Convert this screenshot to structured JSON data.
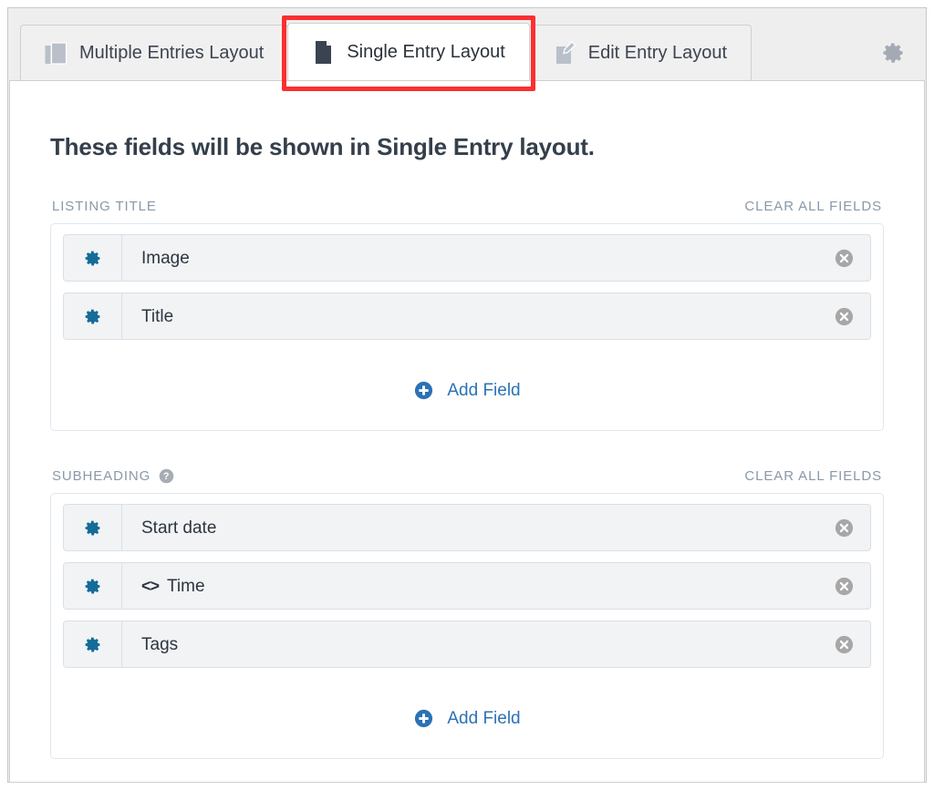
{
  "tabs": [
    {
      "label": "Multiple Entries Layout",
      "icon": "stacked-pages-icon",
      "active": false
    },
    {
      "label": "Single Entry Layout",
      "icon": "single-page-icon",
      "active": true
    },
    {
      "label": "Edit Entry Layout",
      "icon": "pencil-edit-icon",
      "active": false
    }
  ],
  "toolbar": {
    "settings_icon": "gear-icon"
  },
  "annotation": {
    "color": "#fc2f30",
    "target": "Single Entry Layout"
  },
  "main": {
    "title": "These fields will be shown in Single Entry layout.",
    "clear_all_label": "CLEAR ALL FIELDS",
    "add_field_label": "Add Field",
    "sections": [
      {
        "label": "LISTING TITLE",
        "has_help": false,
        "fields": [
          {
            "label": "Image",
            "prefix": "",
            "gear_icon": "gear-icon",
            "remove_icon": "remove-circle-icon"
          },
          {
            "label": "Title",
            "prefix": "",
            "gear_icon": "gear-icon",
            "remove_icon": "remove-circle-icon"
          }
        ]
      },
      {
        "label": "SUBHEADING",
        "has_help": true,
        "help_icon": "question-mark-circle-icon",
        "fields": [
          {
            "label": "Start date",
            "prefix": "",
            "gear_icon": "gear-icon",
            "remove_icon": "remove-circle-icon"
          },
          {
            "label": "Time",
            "prefix": "<>",
            "gear_icon": "gear-icon",
            "remove_icon": "remove-circle-icon"
          },
          {
            "label": "Tags",
            "prefix": "",
            "gear_icon": "gear-icon",
            "remove_icon": "remove-circle-icon"
          }
        ]
      }
    ]
  },
  "colors": {
    "accent_blue": "#2b72b5",
    "gear_blue": "#156c98",
    "label_gray": "#8a98a8",
    "annotation_red": "#fc2f30",
    "group_border": "#dfe7ef",
    "row_bg": "#f1f3f5"
  }
}
